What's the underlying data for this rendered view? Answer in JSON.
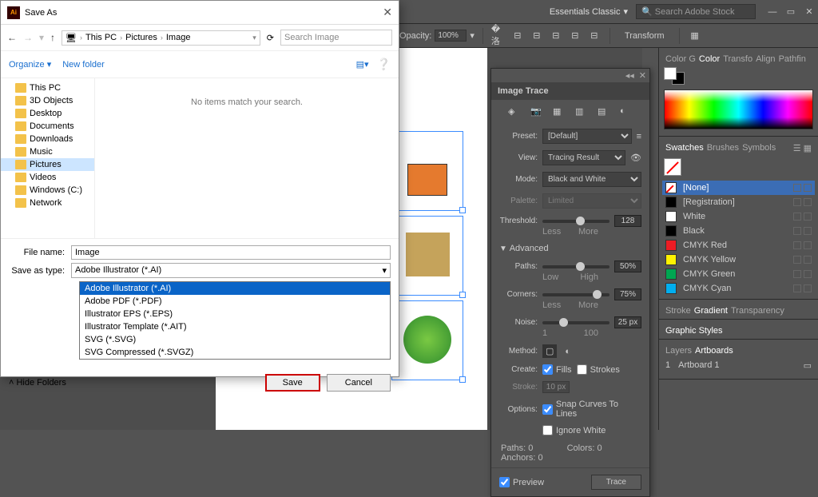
{
  "app": {
    "workspace": "Essentials Classic",
    "search_placeholder": "Search Adobe Stock"
  },
  "control": {
    "opacity_label": "Opacity:",
    "opacity_value": "100%",
    "transform": "Transform"
  },
  "save_dialog": {
    "title": "Save As",
    "breadcrumb": [
      "This PC",
      "Pictures",
      "Image"
    ],
    "search_placeholder": "Search Image",
    "organize": "Organize",
    "new_folder": "New folder",
    "tree": [
      {
        "label": "This PC"
      },
      {
        "label": "3D Objects"
      },
      {
        "label": "Desktop"
      },
      {
        "label": "Documents"
      },
      {
        "label": "Downloads"
      },
      {
        "label": "Music"
      },
      {
        "label": "Pictures",
        "selected": true
      },
      {
        "label": "Videos"
      },
      {
        "label": "Windows (C:)"
      },
      {
        "label": "Network"
      }
    ],
    "empty_message": "No items match your search.",
    "filename_label": "File name:",
    "filename_value": "Image",
    "savetype_label": "Save as type:",
    "savetype_value": "Adobe Illustrator (*.AI)",
    "type_options": [
      "Adobe Illustrator (*.AI)",
      "Adobe PDF (*.PDF)",
      "Illustrator EPS (*.EPS)",
      "Illustrator Template (*.AIT)",
      "SVG (*.SVG)",
      "SVG Compressed (*.SVGZ)"
    ],
    "hide_folders": "Hide Folders",
    "save": "Save",
    "cancel": "Cancel"
  },
  "trace": {
    "title": "Image Trace",
    "preset_label": "Preset:",
    "preset_value": "[Default]",
    "view_label": "View:",
    "view_value": "Tracing Result",
    "mode_label": "Mode:",
    "mode_value": "Black and White",
    "palette_label": "Palette:",
    "palette_value": "Limited",
    "threshold_label": "Threshold:",
    "threshold_value": "128",
    "less": "Less",
    "more": "More",
    "advanced": "Advanced",
    "paths_label": "Paths:",
    "paths_value": "50%",
    "low": "Low",
    "high": "High",
    "corners_label": "Corners:",
    "corners_value": "75%",
    "noise_label": "Noise:",
    "noise_value": "25 px",
    "min1": "1",
    "max100": "100",
    "method_label": "Method:",
    "create_label": "Create:",
    "fills": "Fills",
    "strokes": "Strokes",
    "stroke_label": "Stroke:",
    "stroke_value": "10 px",
    "options_label": "Options:",
    "snap": "Snap Curves To Lines",
    "ignore": "Ignore White",
    "paths_info": "Paths:",
    "paths_count": "0",
    "colors_info": "Colors:",
    "colors_count": "0",
    "anchors_info": "Anchors:",
    "anchors_count": "0",
    "preview": "Preview",
    "trace_btn": "Trace"
  },
  "panels": {
    "color_tabs": [
      "Color G",
      "Color",
      "Transfo",
      "Align",
      "Pathfin"
    ],
    "swatch_tabs": [
      "Swatches",
      "Brushes",
      "Symbols"
    ],
    "swatches": [
      {
        "name": "[None]",
        "color": "none",
        "selected": true
      },
      {
        "name": "[Registration]",
        "color": "#000"
      },
      {
        "name": "White",
        "color": "#fff"
      },
      {
        "name": "Black",
        "color": "#000"
      },
      {
        "name": "CMYK Red",
        "color": "#ed1c24"
      },
      {
        "name": "CMYK Yellow",
        "color": "#fff200"
      },
      {
        "name": "CMYK Green",
        "color": "#00a651"
      },
      {
        "name": "CMYK Cyan",
        "color": "#00aeef"
      }
    ],
    "grad_tabs": [
      "Stroke",
      "Gradient",
      "Transparency"
    ],
    "styles_tab": "Graphic Styles",
    "layer_tabs": [
      "Layers",
      "Artboards"
    ],
    "artboard_num": "1",
    "artboard_name": "Artboard 1"
  }
}
